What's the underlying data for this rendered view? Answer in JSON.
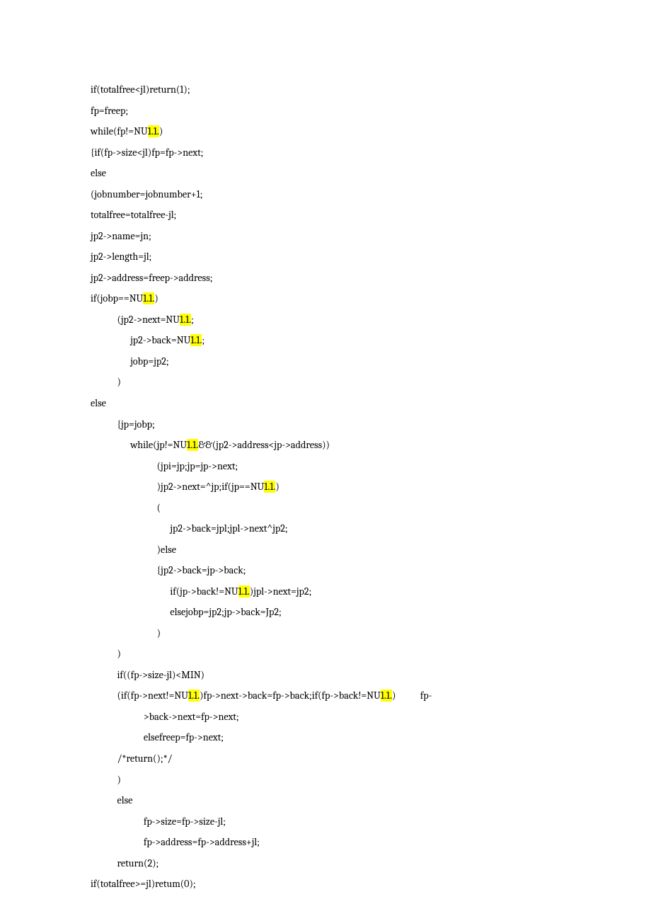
{
  "code": {
    "lines": [
      {
        "indent": 0,
        "segments": [
          {
            "t": "if(totalfree<jl)return(1);"
          }
        ]
      },
      {
        "indent": 0,
        "segments": [
          {
            "t": "fp=freep;"
          }
        ]
      },
      {
        "indent": 0,
        "segments": [
          {
            "t": "while(fp!=NU"
          },
          {
            "t": "1.1.",
            "hl": true
          },
          {
            "t": ")"
          }
        ]
      },
      {
        "indent": 0,
        "segments": [
          {
            "t": "{if(fp->size<jl)fp=fp->next;"
          }
        ]
      },
      {
        "indent": 0,
        "segments": [
          {
            "t": "else"
          }
        ]
      },
      {
        "indent": 0,
        "segments": [
          {
            "t": "(jobnumber=jobnumber+1;"
          }
        ]
      },
      {
        "indent": 0,
        "segments": [
          {
            "t": "totalfree=totalfree-jl;"
          }
        ]
      },
      {
        "indent": 0,
        "segments": [
          {
            "t": "jp2->name=jn;"
          }
        ]
      },
      {
        "indent": 0,
        "segments": [
          {
            "t": "jp2->length=jl;"
          }
        ]
      },
      {
        "indent": 0,
        "segments": [
          {
            "t": "jp2->address=freep->address;"
          }
        ]
      },
      {
        "indent": 0,
        "segments": [
          {
            "t": "if(jobp==NU"
          },
          {
            "t": "1.1.",
            "hl": true
          },
          {
            "t": ")"
          }
        ]
      },
      {
        "indent": 2,
        "segments": [
          {
            "t": "(jp2->next=NU"
          },
          {
            "t": "1.1.",
            "hl": true
          },
          {
            "t": ";"
          }
        ]
      },
      {
        "indent": 3,
        "segments": [
          {
            "t": "jp2->back=NU"
          },
          {
            "t": "1.1.",
            "hl": true
          },
          {
            "t": ";"
          }
        ]
      },
      {
        "indent": 3,
        "segments": [
          {
            "t": "jobp=jp2;"
          }
        ]
      },
      {
        "indent": 2,
        "segments": [
          {
            "t": ")"
          }
        ]
      },
      {
        "indent": 0,
        "segments": [
          {
            "t": "else"
          }
        ]
      },
      {
        "indent": 2,
        "segments": [
          {
            "t": "{jp=jobp;"
          }
        ]
      },
      {
        "indent": 3,
        "segments": [
          {
            "t": "while(jp!=NU"
          },
          {
            "t": "1.1.",
            "hl": true
          },
          {
            "t": "&&(jp2->address<jp->address))"
          }
        ]
      },
      {
        "indent": 5,
        "segments": [
          {
            "t": "(jpi=jp;jp=jp->next;"
          }
        ]
      },
      {
        "indent": 5,
        "segments": [
          {
            "t": ")jp2->next=^jp;if(jp==NU"
          },
          {
            "t": "1.1.",
            "hl": true
          },
          {
            "t": ")"
          }
        ]
      },
      {
        "indent": 5,
        "segments": [
          {
            "t": "("
          }
        ]
      },
      {
        "indent": 6,
        "segments": [
          {
            "t": "jp2->back=jpl;jpl->next^jp2;"
          }
        ]
      },
      {
        "indent": 5,
        "segments": [
          {
            "t": ")else"
          }
        ]
      },
      {
        "indent": 5,
        "segments": [
          {
            "t": "{jp2->back=jp->back;"
          }
        ]
      },
      {
        "indent": 6,
        "segments": [
          {
            "t": "if(jp->back!=NU"
          },
          {
            "t": "1.1.",
            "hl": true
          },
          {
            "t": ")jpl->next=jp2;"
          }
        ]
      },
      {
        "indent": 6,
        "segments": [
          {
            "t": "elsejobp=jp2;jp->back=Jp2;"
          }
        ]
      },
      {
        "indent": 5,
        "segments": [
          {
            "t": ")"
          }
        ]
      },
      {
        "indent": 2,
        "segments": [
          {
            "t": ")"
          }
        ]
      },
      {
        "indent": 2,
        "segments": [
          {
            "t": "if((fp->size-jl)<MIN)"
          }
        ]
      },
      {
        "indent": 2,
        "segments": [
          {
            "t": "(if(fp->next!=NU"
          },
          {
            "t": "1.1.",
            "hl": true
          },
          {
            "t": ")fp->next->back=fp->back;if(fp->back!=NU"
          },
          {
            "t": "1.1.",
            "hl": true
          },
          {
            "t": ")           fp-"
          }
        ]
      },
      {
        "indent": 4,
        "segments": [
          {
            "t": ">back->next=fp->next;"
          }
        ]
      },
      {
        "indent": 4,
        "segments": [
          {
            "t": "elsefreep=fp->next;"
          }
        ]
      },
      {
        "indent": 2,
        "segments": [
          {
            "t": "/*return();*/"
          }
        ]
      },
      {
        "indent": 2,
        "segments": [
          {
            "t": ")"
          }
        ]
      },
      {
        "indent": 2,
        "segments": [
          {
            "t": "else"
          }
        ]
      },
      {
        "indent": 0,
        "segments": [
          {
            "t": ""
          }
        ]
      },
      {
        "indent": 4,
        "segments": [
          {
            "t": "fp->size=fp->size-jl;"
          }
        ]
      },
      {
        "indent": 4,
        "segments": [
          {
            "t": "fp->address=fp->address+jl;"
          }
        ]
      },
      {
        "indent": 2,
        "segments": [
          {
            "t": "return(2);"
          }
        ]
      },
      {
        "indent": 0,
        "segments": [
          {
            "t": ""
          }
        ]
      },
      {
        "indent": 0,
        "segments": [
          {
            "t": "if(totalfree>=jl)retum(0);"
          }
        ]
      }
    ]
  },
  "indent_unit": "      "
}
